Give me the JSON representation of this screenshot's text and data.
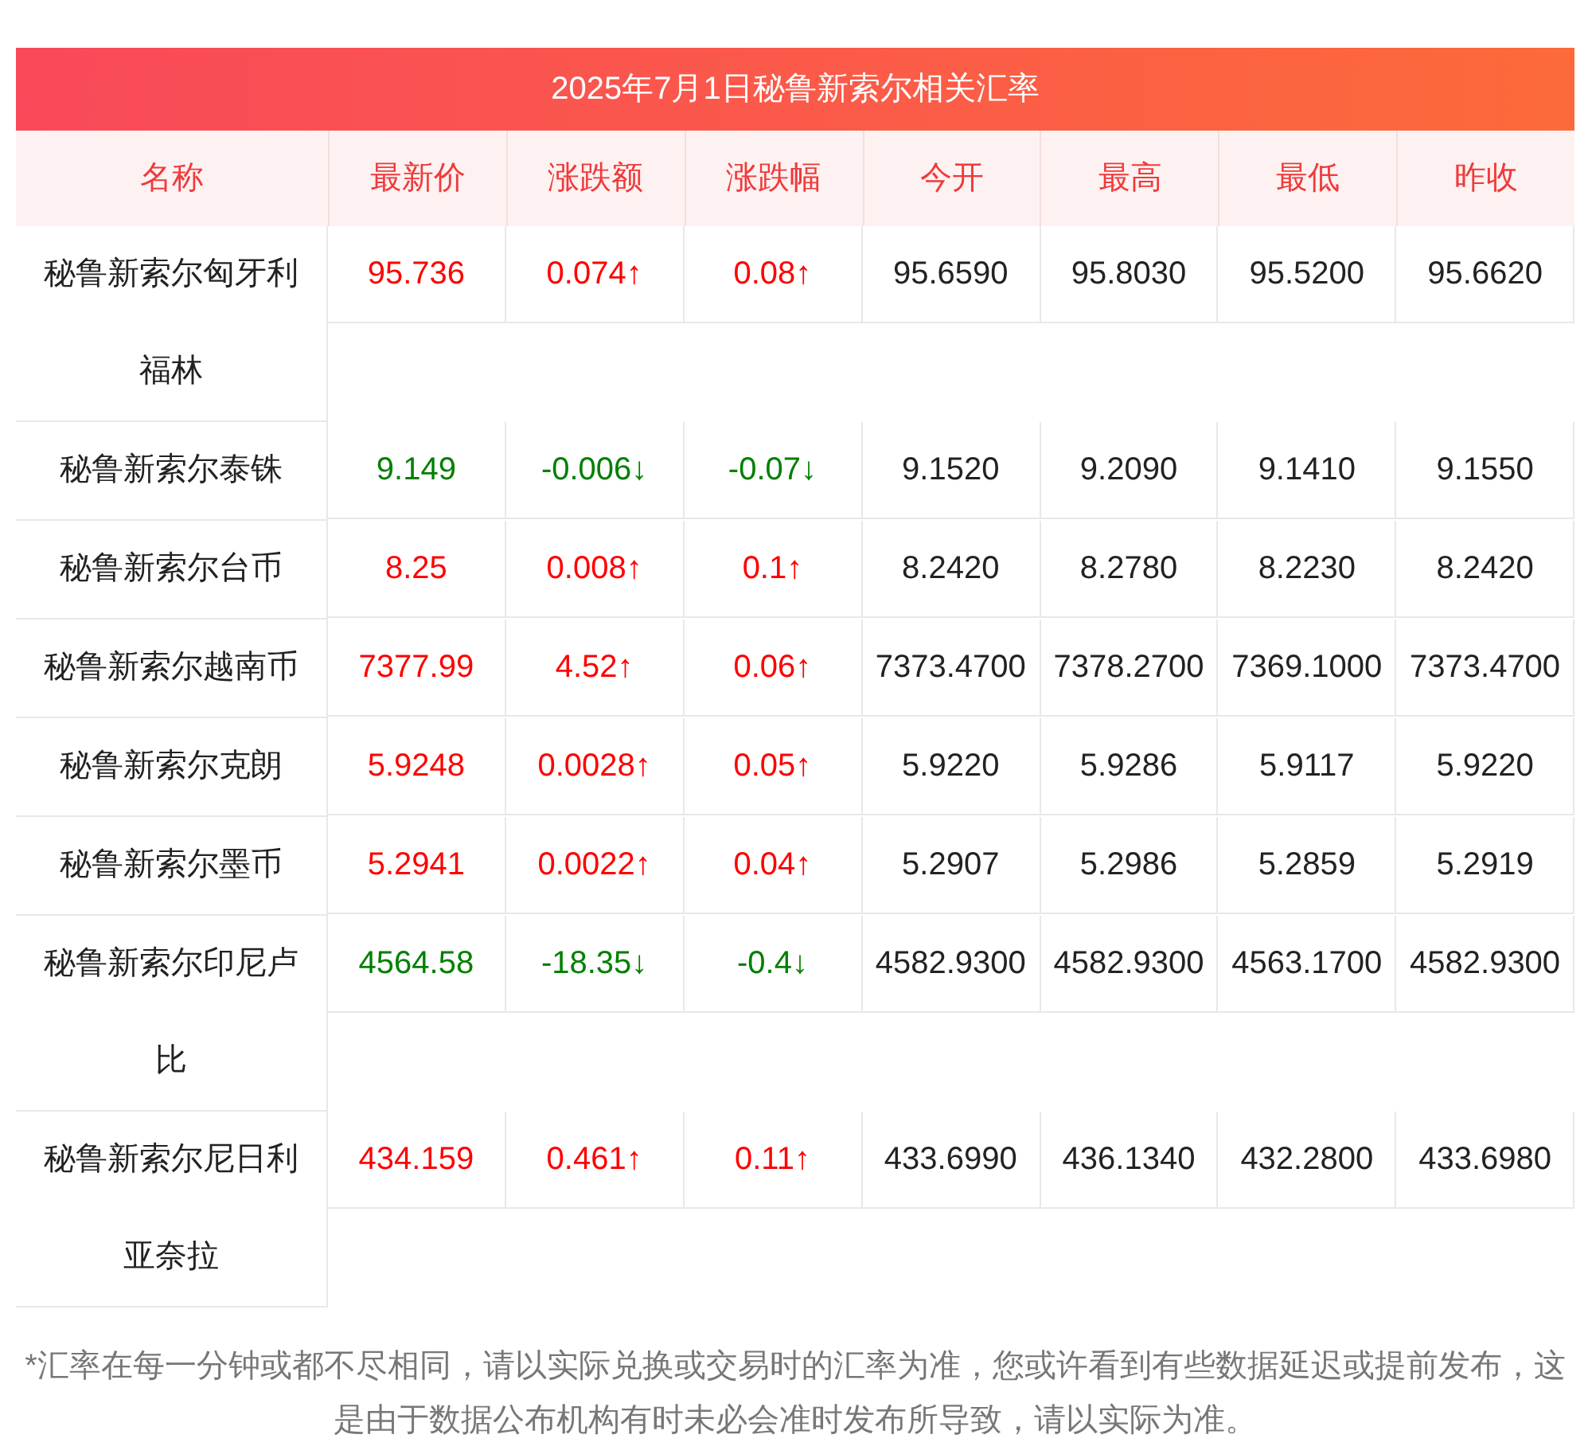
{
  "title": "2025年7月1日秘鲁新索尔相关汇率",
  "columns": [
    "名称",
    "最新价",
    "涨跌额",
    "涨跌幅",
    "今开",
    "最高",
    "最低",
    "昨收"
  ],
  "rows": [
    {
      "name": "秘鲁新索尔匈牙利福林",
      "color": "#ff0000",
      "latest": "95.736",
      "change": "0.074↑",
      "change_pct": "0.08↑",
      "open": "95.6590",
      "high": "95.8030",
      "low": "95.5200",
      "prev_close": "95.6620"
    },
    {
      "name": "秘鲁新索尔泰铢",
      "color": "#008000",
      "latest": "9.149",
      "change": "-0.006↓",
      "change_pct": "-0.07↓",
      "open": "9.1520",
      "high": "9.2090",
      "low": "9.1410",
      "prev_close": "9.1550"
    },
    {
      "name": "秘鲁新索尔台币",
      "color": "#ff0000",
      "latest": "8.25",
      "change": "0.008↑",
      "change_pct": "0.1↑",
      "open": "8.2420",
      "high": "8.2780",
      "low": "8.2230",
      "prev_close": "8.2420"
    },
    {
      "name": "秘鲁新索尔越南币",
      "color": "#ff0000",
      "latest": "7377.99",
      "change": "4.52↑",
      "change_pct": "0.06↑",
      "open": "7373.4700",
      "high": "7378.2700",
      "low": "7369.1000",
      "prev_close": "7373.4700"
    },
    {
      "name": "秘鲁新索尔克朗",
      "color": "#ff0000",
      "latest": "5.9248",
      "change": "0.0028↑",
      "change_pct": "0.05↑",
      "open": "5.9220",
      "high": "5.9286",
      "low": "5.9117",
      "prev_close": "5.9220"
    },
    {
      "name": "秘鲁新索尔墨币",
      "color": "#ff0000",
      "latest": "5.2941",
      "change": "0.0022↑",
      "change_pct": "0.04↑",
      "open": "5.2907",
      "high": "5.2986",
      "low": "5.2859",
      "prev_close": "5.2919"
    },
    {
      "name": "秘鲁新索尔印尼卢比",
      "color": "#008000",
      "latest": "4564.58",
      "change": "-18.35↓",
      "change_pct": "-0.4↓",
      "open": "4582.9300",
      "high": "4582.9300",
      "low": "4563.1700",
      "prev_close": "4582.9300"
    },
    {
      "name": "秘鲁新索尔尼日利亚奈拉",
      "color": "#ff0000",
      "latest": "434.159",
      "change": "0.461↑",
      "change_pct": "0.11↑",
      "open": "433.6990",
      "high": "436.1340",
      "low": "432.2800",
      "prev_close": "433.6980"
    }
  ],
  "footnote": "*汇率在每一分钟或都不尽相同，请以实际兑换或交易时的汇率为准，您或许看到有些数据延迟或提前发布，这是由于数据公布机构有时未必会准时发布所导致，请以实际为准。"
}
